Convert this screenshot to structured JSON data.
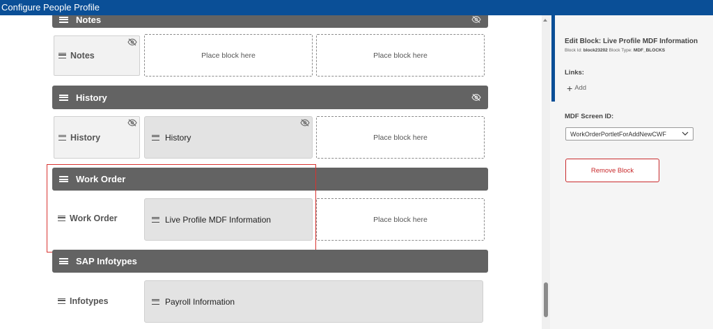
{
  "window": {
    "title": "Configure People Profile"
  },
  "sections": [
    {
      "title": "Notes",
      "block_label": "Notes",
      "slots": [
        "Place block here",
        "Place block here"
      ]
    },
    {
      "title": "History",
      "block_label": "History",
      "filled_block": "History",
      "slots": [
        "Place block here"
      ]
    },
    {
      "title": "Work Order",
      "block_label": "Work Order",
      "filled_block": "Live Profile MDF Information",
      "slots": [
        "Place block here"
      ]
    },
    {
      "title": "SAP Infotypes",
      "block_label": "Infotypes",
      "filled_block": "Payroll Information"
    }
  ],
  "side_panel": {
    "title": "Edit Block: Live Profile MDF Information",
    "block_id_label": "Block Id:",
    "block_id": "block23202",
    "block_type_label": "Block Type:",
    "block_type": "MDF_BLOCKS",
    "links_label": "Links:",
    "add_label": "Add",
    "mdf_screen_label": "MDF Screen ID:",
    "mdf_screen_value": "WorkOrderPortletForAddNewCWF",
    "remove_label": "Remove Block"
  },
  "colors": {
    "titlebar": "#0a4f97",
    "section_header": "#636363",
    "highlight": "#d8322f",
    "remove": "#c8282a"
  },
  "icons": [
    "hamburger-icon",
    "hidden-eye-icon",
    "chevron-down-icon",
    "plus-icon"
  ]
}
